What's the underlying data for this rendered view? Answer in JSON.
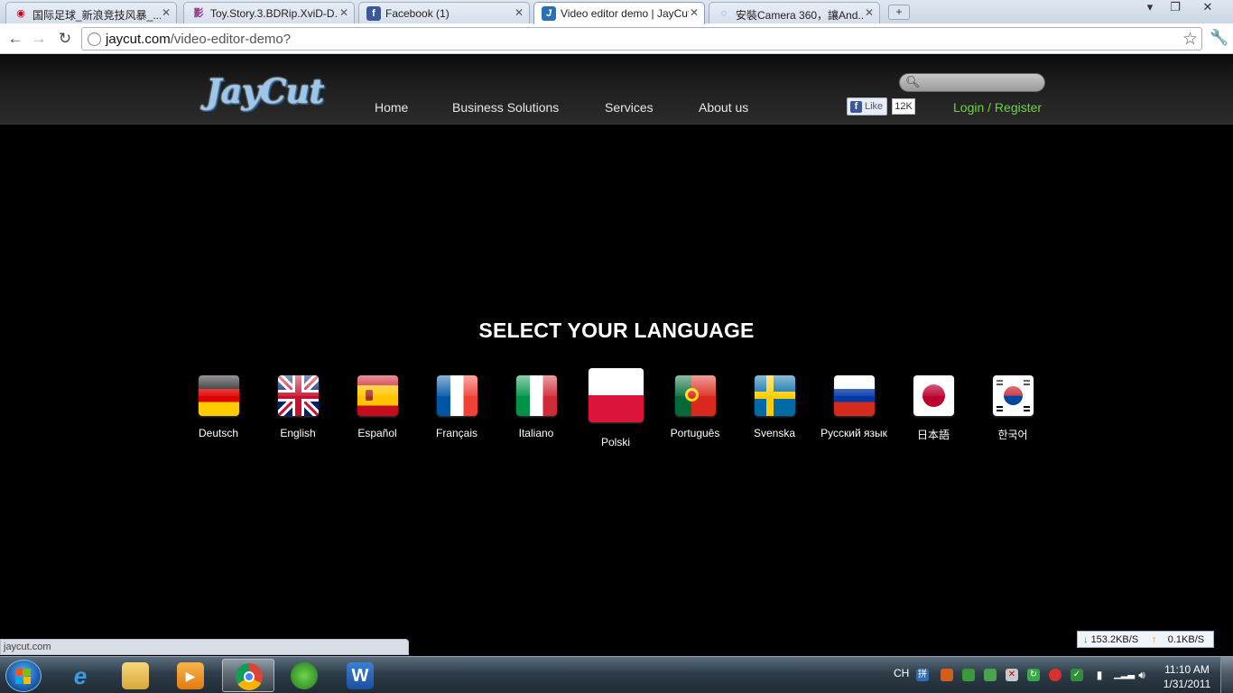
{
  "browser": {
    "tabs": [
      {
        "title": "国际足球_新浪竞技风暴_...",
        "active": false
      },
      {
        "title": "Toy.Story.3.BDRip.XviD-D...",
        "active": false
      },
      {
        "title": "Facebook (1)",
        "active": false
      },
      {
        "title": "Video editor demo | JayCut",
        "active": true
      },
      {
        "title": "安裝Camera 360，讓And...",
        "active": false
      }
    ],
    "new_tab_label": "+",
    "url_host": "jaycut.com",
    "url_path": "/video-editor-demo?"
  },
  "site": {
    "logo": "JayCut",
    "nav": [
      "Home",
      "Business Solutions",
      "Services",
      "About us"
    ],
    "search": {
      "placeholder": ""
    },
    "fb_like_label": "Like",
    "fb_like_count": "12K",
    "login_label": "Login / Register"
  },
  "main": {
    "heading": "SELECT YOUR LANGUAGE",
    "languages": [
      {
        "name": "Deutsch",
        "flag": "germany-flag"
      },
      {
        "name": "English",
        "flag": "uk-flag"
      },
      {
        "name": "Español",
        "flag": "spain-flag"
      },
      {
        "name": "Français",
        "flag": "france-flag"
      },
      {
        "name": "Italiano",
        "flag": "italy-flag"
      },
      {
        "name": "Polski",
        "flag": "poland-flag",
        "highlighted": true
      },
      {
        "name": "Português",
        "flag": "portugal-flag"
      },
      {
        "name": "Svenska",
        "flag": "sweden-flag"
      },
      {
        "name": "Русский язык",
        "flag": "russia-flag"
      },
      {
        "name": "日本語",
        "flag": "japan-flag"
      },
      {
        "name": "한국어",
        "flag": "korea-flag"
      }
    ]
  },
  "status": {
    "link": "jaycut.com",
    "download": "153.2KB/S",
    "upload": "0.1KB/S"
  },
  "taskbar": {
    "input_lang": "CH",
    "time": "11:10 AM",
    "date": "1/31/2011"
  },
  "colors": {
    "page_bg": "#000000",
    "login_green": "#6ed43f",
    "logo_blue": "#9cc6ea"
  }
}
